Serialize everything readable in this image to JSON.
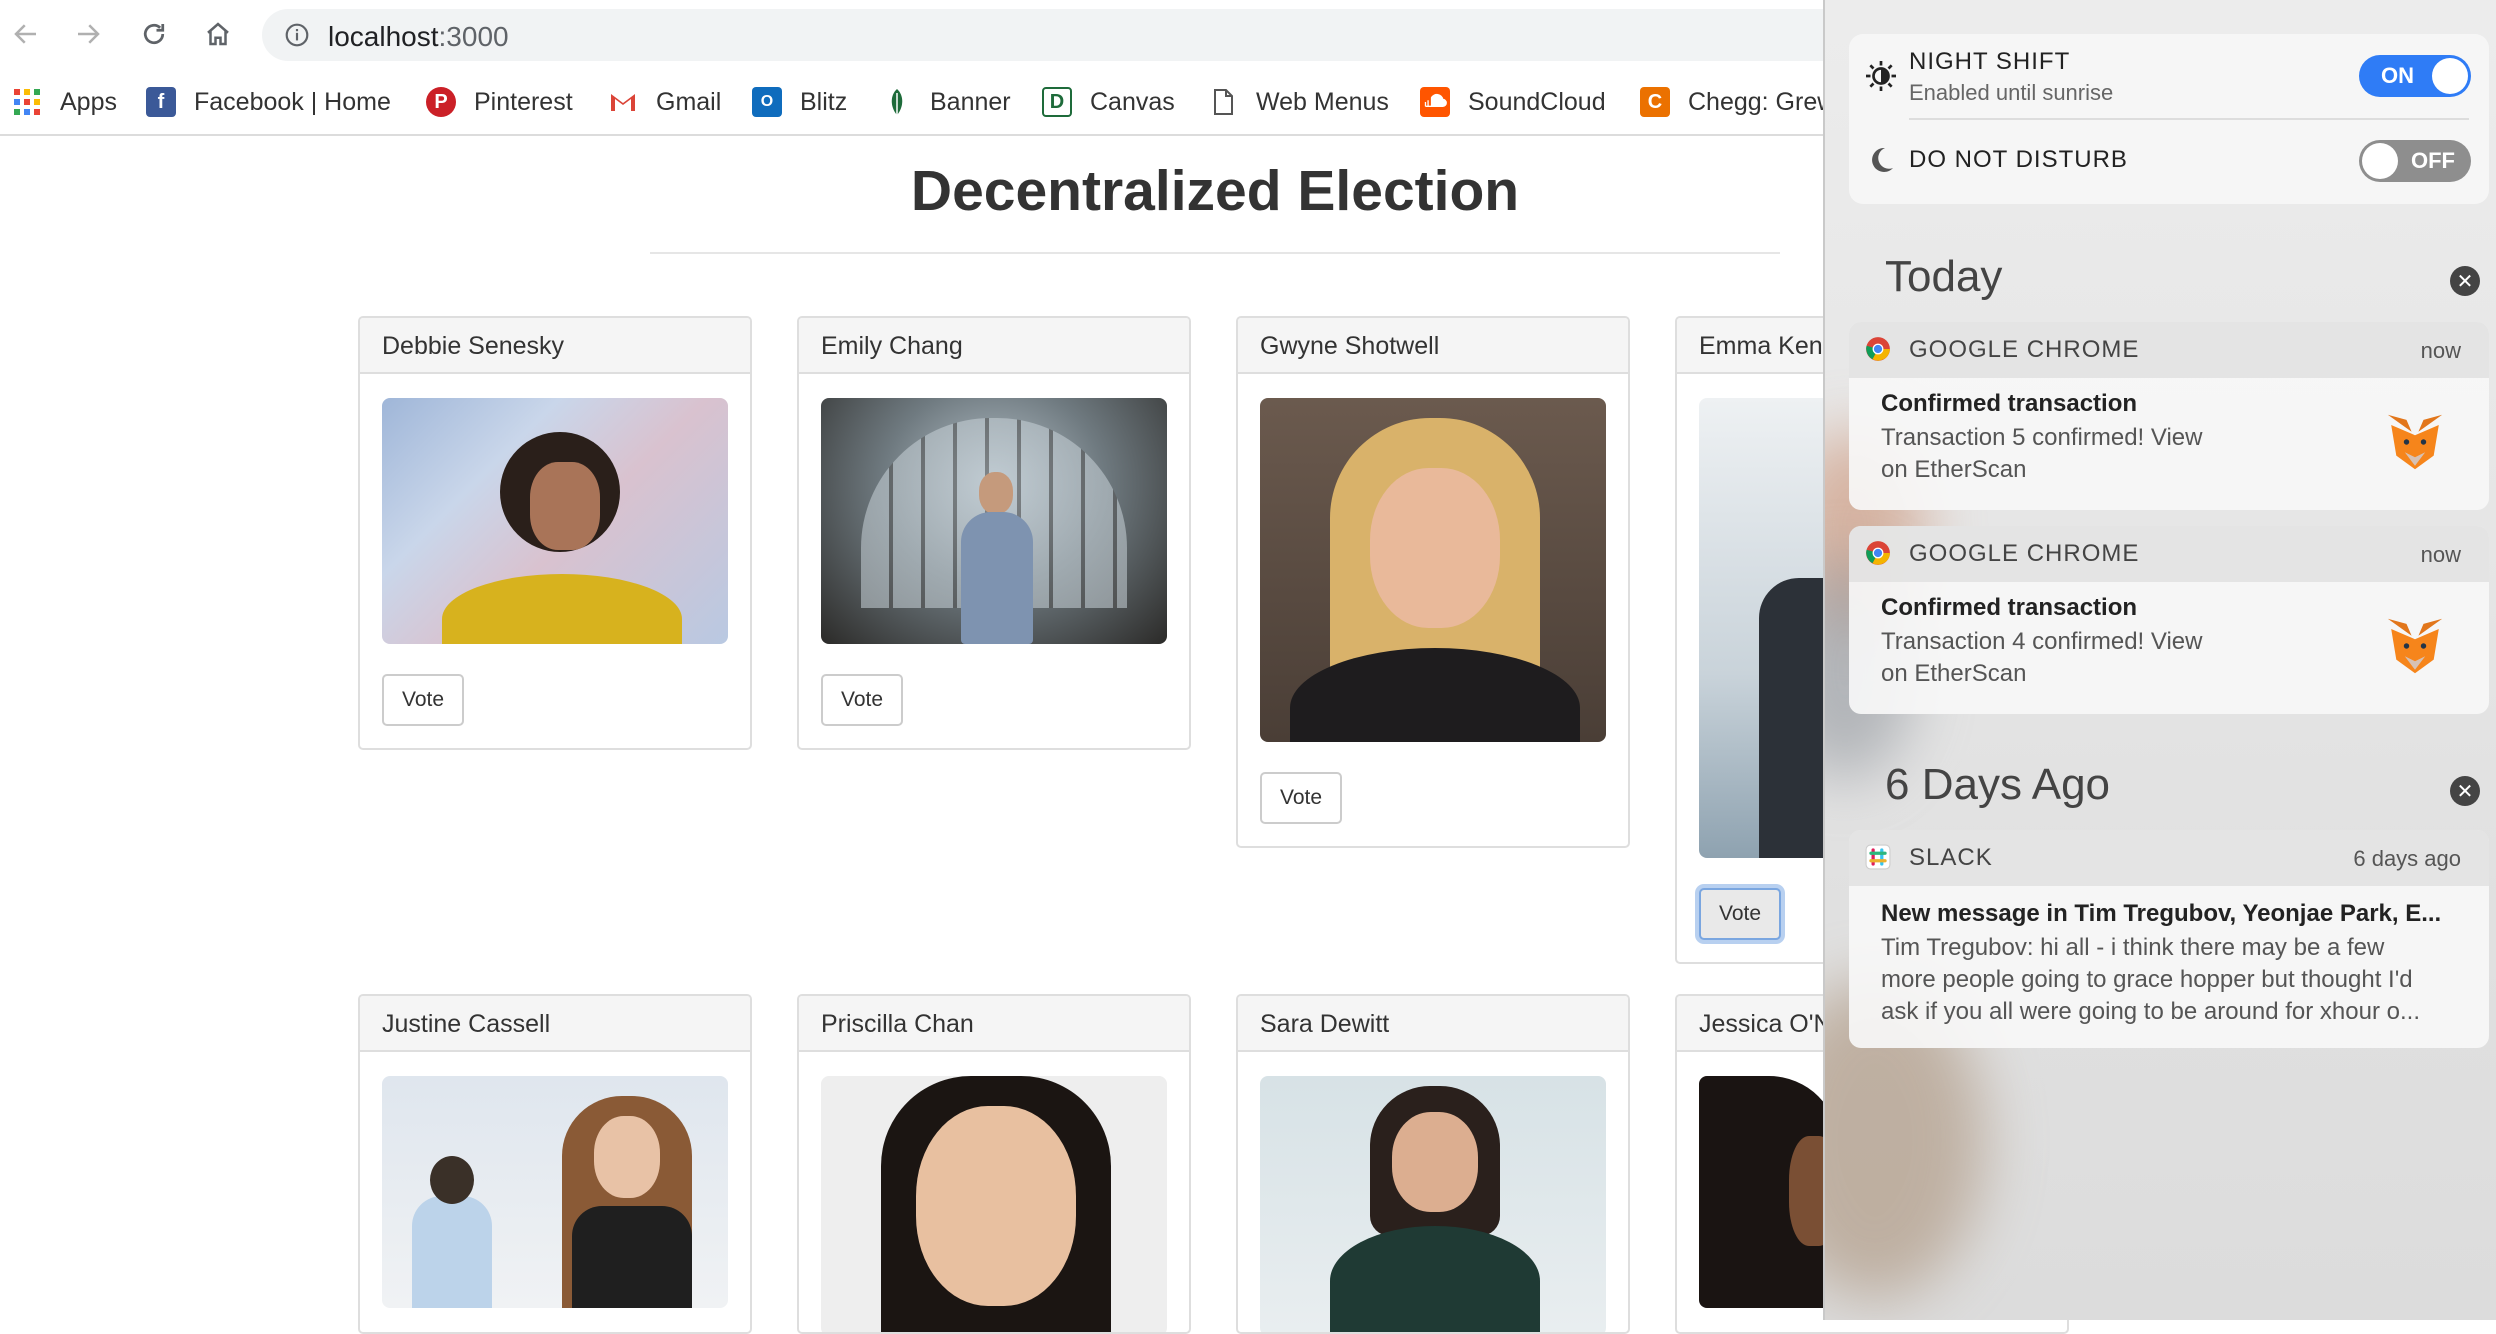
{
  "browser": {
    "url": "localhost",
    "url_port": ":3000",
    "bookmarks": [
      {
        "label": "Apps",
        "icon": "apps-grid-icon"
      },
      {
        "label": "Facebook | Home",
        "icon": "facebook-icon"
      },
      {
        "label": "Pinterest",
        "icon": "pinterest-icon"
      },
      {
        "label": "Gmail",
        "icon": "gmail-icon"
      },
      {
        "label": "Blitz",
        "icon": "outlook-icon"
      },
      {
        "label": "Banner",
        "icon": "leaf-icon"
      },
      {
        "label": "Canvas",
        "icon": "canvas-icon"
      },
      {
        "label": "Web Menus",
        "icon": "document-icon"
      },
      {
        "label": "SoundCloud",
        "icon": "soundcloud-icon"
      },
      {
        "label": "Chegg: Grew",
        "icon": "chegg-icon"
      }
    ]
  },
  "page": {
    "title": "Decentralized Election",
    "vote_label": "Vote",
    "candidates": [
      {
        "name": "Debbie Senesky"
      },
      {
        "name": "Emily Chang"
      },
      {
        "name": "Gwyne Shotwell"
      },
      {
        "name": "Emma Kenn"
      },
      {
        "name": "Justine Cassell"
      },
      {
        "name": "Priscilla Chan"
      },
      {
        "name": "Sara Dewitt"
      },
      {
        "name": "Jessica O'N"
      }
    ]
  },
  "notification_center": {
    "night_shift": {
      "label": "NIGHT SHIFT",
      "sub": "Enabled until sunrise",
      "state": "ON"
    },
    "do_not_disturb": {
      "label": "DO NOT DISTURB",
      "state": "OFF"
    },
    "sections": [
      {
        "title": "Today",
        "notifications": [
          {
            "app": "GOOGLE CHROME",
            "time": "now",
            "title": "Confirmed transaction",
            "line1": "Transaction 5 confirmed! View",
            "line2": "on EtherScan"
          },
          {
            "app": "GOOGLE CHROME",
            "time": "now",
            "title": "Confirmed transaction",
            "line1": "Transaction 4 confirmed! View",
            "line2": "on EtherScan"
          }
        ]
      },
      {
        "title": "6 Days Ago",
        "notifications": [
          {
            "app": "SLACK",
            "time": "6 days ago",
            "title": "New message in Tim Tregubov, Yeonjae Park, E...",
            "line1": "Tim Tregubov: hi all - i think there may be a few",
            "line2": "more people going to grace hopper but thought I'd",
            "line3": "ask if you all were going to be around for xhour o..."
          }
        ]
      }
    ]
  },
  "colors": {
    "toggle_on": "#2f7cf6",
    "toggle_off": "#8e8e8e",
    "focus_ring": "#b8d0f0"
  }
}
